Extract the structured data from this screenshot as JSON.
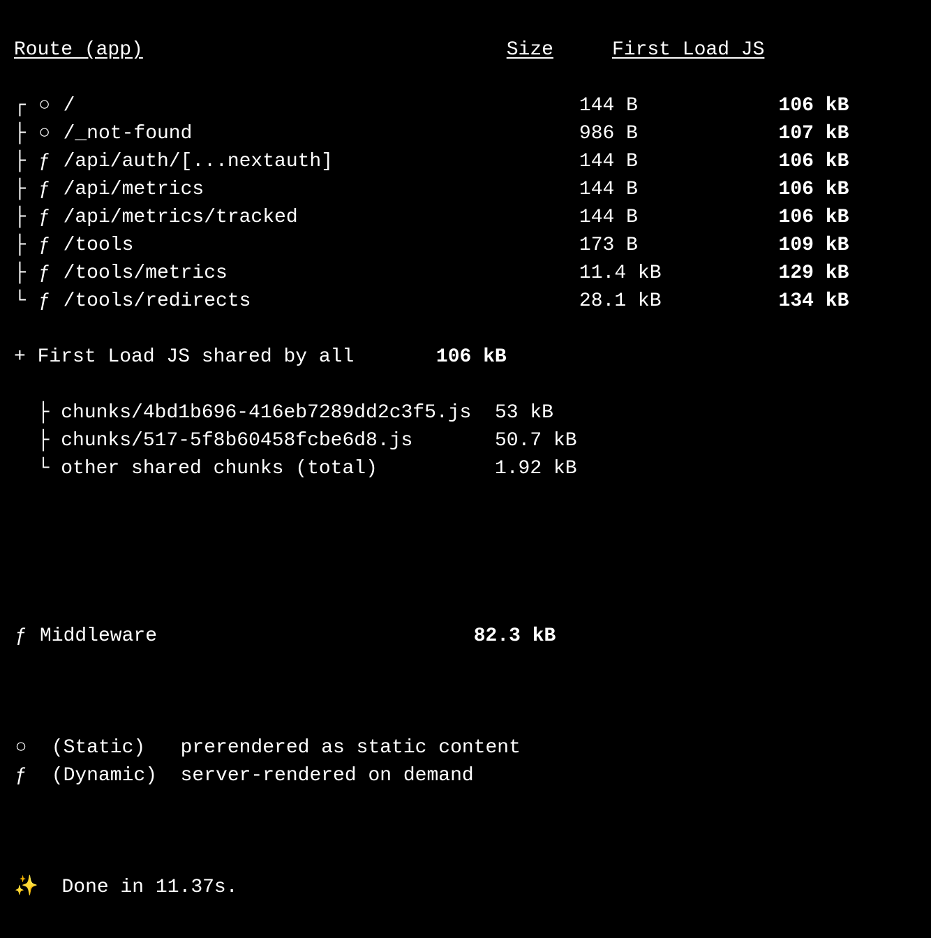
{
  "headers": {
    "route": "Route (app)",
    "size": "Size",
    "first_load": "First Load JS"
  },
  "routes": [
    {
      "tree": "┌ ",
      "sym": "○",
      "path": "/",
      "size": "144 B",
      "first": "106 kB"
    },
    {
      "tree": "├ ",
      "sym": "○",
      "path": "/_not-found",
      "size": "986 B",
      "first": "107 kB"
    },
    {
      "tree": "├ ",
      "sym": "ƒ",
      "path": "/api/auth/[...nextauth]",
      "size": "144 B",
      "first": "106 kB"
    },
    {
      "tree": "├ ",
      "sym": "ƒ",
      "path": "/api/metrics",
      "size": "144 B",
      "first": "106 kB"
    },
    {
      "tree": "├ ",
      "sym": "ƒ",
      "path": "/api/metrics/tracked",
      "size": "144 B",
      "first": "106 kB"
    },
    {
      "tree": "├ ",
      "sym": "ƒ",
      "path": "/tools",
      "size": "173 B",
      "first": "109 kB"
    },
    {
      "tree": "├ ",
      "sym": "ƒ",
      "path": "/tools/metrics",
      "size": "11.4 kB",
      "first": "129 kB"
    },
    {
      "tree": "└ ",
      "sym": "ƒ",
      "path": "/tools/redirects",
      "size": "28.1 kB",
      "first": "134 kB"
    }
  ],
  "shared": {
    "label": "+ First Load JS shared by all",
    "size": "106 kB",
    "chunks": [
      {
        "tree": "  ├ ",
        "name": "chunks/4bd1b696-416eb7289dd2c3f5.js",
        "size": "53 kB"
      },
      {
        "tree": "  ├ ",
        "name": "chunks/517-5f8b60458fcbe6d8.js",
        "size": "50.7 kB"
      },
      {
        "tree": "  └ ",
        "name": "other shared chunks (total)",
        "size": "1.92 kB"
      }
    ]
  },
  "middleware": {
    "sym": "ƒ",
    "label": "Middleware",
    "size": "82.3 kB"
  },
  "legend": [
    {
      "sym": "○",
      "name": "(Static)",
      "desc": "prerendered as static content"
    },
    {
      "sym": "ƒ",
      "name": "(Dynamic)",
      "desc": "server-rendered on demand"
    }
  ],
  "done": {
    "icon": "✨",
    "text": "Done in 11.37s."
  }
}
